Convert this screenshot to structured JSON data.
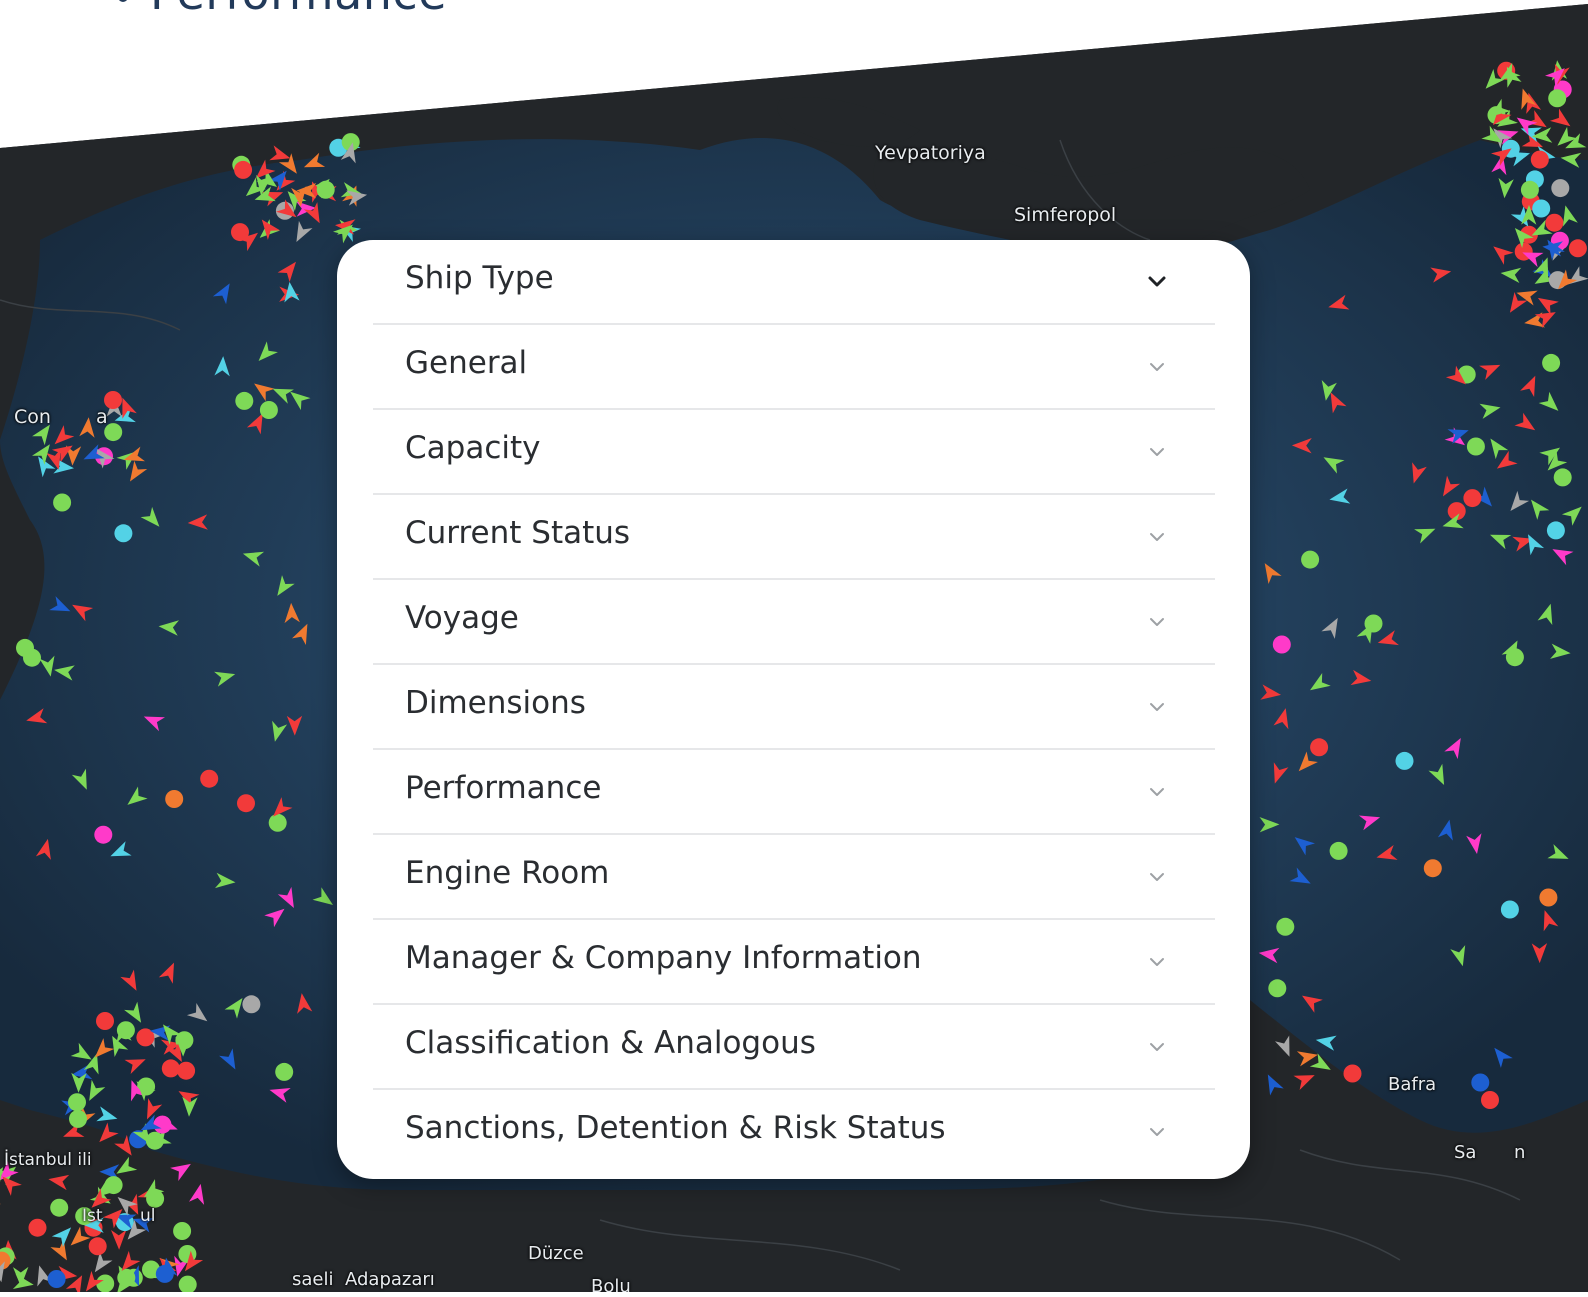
{
  "heading": {
    "text": "Performance"
  },
  "map": {
    "places": [
      {
        "name": "Yevpatoriya"
      },
      {
        "name": "Simferopol"
      },
      {
        "name": "Con"
      },
      {
        "name": "a"
      },
      {
        "name": "İstanbul ili"
      },
      {
        "name": "Ist"
      },
      {
        "name": "ul"
      },
      {
        "name": "Düzce"
      },
      {
        "name": "saeli"
      },
      {
        "name": "Adapazarı"
      },
      {
        "name": "Bolu"
      },
      {
        "name": "Bafra"
      },
      {
        "name": "Sa"
      },
      {
        "name": "n"
      }
    ],
    "vessel_colors": [
      "#7ed957",
      "#f23a3a",
      "#53d2e6",
      "#ff3ac9",
      "#a8a8a8",
      "#f07a30",
      "#1d5fd1"
    ]
  },
  "filter_panel": {
    "items": [
      {
        "label": "Ship Type",
        "expanded_indicator": "chevron-down",
        "active": true
      },
      {
        "label": "General",
        "expanded_indicator": "chevron-down",
        "active": false
      },
      {
        "label": "Capacity",
        "expanded_indicator": "chevron-down",
        "active": false
      },
      {
        "label": "Current Status",
        "expanded_indicator": "chevron-down",
        "active": false
      },
      {
        "label": "Voyage",
        "expanded_indicator": "chevron-down",
        "active": false
      },
      {
        "label": "Dimensions",
        "expanded_indicator": "chevron-down",
        "active": false
      },
      {
        "label": "Performance",
        "expanded_indicator": "chevron-down",
        "active": false
      },
      {
        "label": "Engine Room",
        "expanded_indicator": "chevron-down",
        "active": false
      },
      {
        "label": "Manager & Company Information",
        "expanded_indicator": "chevron-down",
        "active": false
      },
      {
        "label": "Classification & Analogous",
        "expanded_indicator": "chevron-down",
        "active": false
      },
      {
        "label": "Sanctions, Detention & Risk Status",
        "expanded_indicator": "chevron-down",
        "active": false
      }
    ]
  }
}
